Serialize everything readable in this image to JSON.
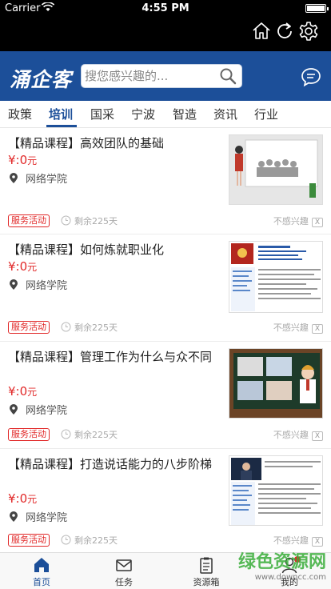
{
  "status_bar": {
    "carrier": "Carrier",
    "time": "4:55 PM"
  },
  "header": {
    "logo": "涌企客",
    "search_placeholder": "搜您感兴趣的..."
  },
  "tabs": [
    "政策",
    "培训",
    "国采",
    "宁波",
    "智造",
    "资讯",
    "行业"
  ],
  "active_tab": "培训",
  "items": [
    {
      "title": "【精品课程】高效团队的基础",
      "price_symbol": "¥:",
      "price": "0",
      "price_unit": "元",
      "location": "网络学院",
      "badge": "服务活动",
      "remaining": "剩余225天",
      "not_interested": "不感兴趣",
      "close": "X"
    },
    {
      "title": "【精品课程】如何炼就职业化",
      "price_symbol": "¥:",
      "price": "0",
      "price_unit": "元",
      "location": "网络学院",
      "badge": "服务活动",
      "remaining": "剩余225天",
      "not_interested": "不感兴趣",
      "close": "X"
    },
    {
      "title": "【精品课程】管理工作为什么与众不同",
      "price_symbol": "¥:",
      "price": "0",
      "price_unit": "元",
      "location": "网络学院",
      "badge": "服务活动",
      "remaining": "剩余225天",
      "not_interested": "不感兴趣",
      "close": "X"
    },
    {
      "title": "【精品课程】打造说话能力的八步阶梯",
      "price_symbol": "¥:",
      "price": "0",
      "price_unit": "元",
      "location": "网络学院",
      "badge": "服务活动",
      "remaining": "剩余225天",
      "not_interested": "不感兴趣",
      "close": "X"
    }
  ],
  "bottom_nav": [
    "首页",
    "任务",
    "资源箱",
    "我的"
  ],
  "watermark": {
    "text": "绿色资源网",
    "url": "www.downcc.com"
  },
  "colors": {
    "brand": "#1c4f99",
    "accent": "#e12828"
  }
}
